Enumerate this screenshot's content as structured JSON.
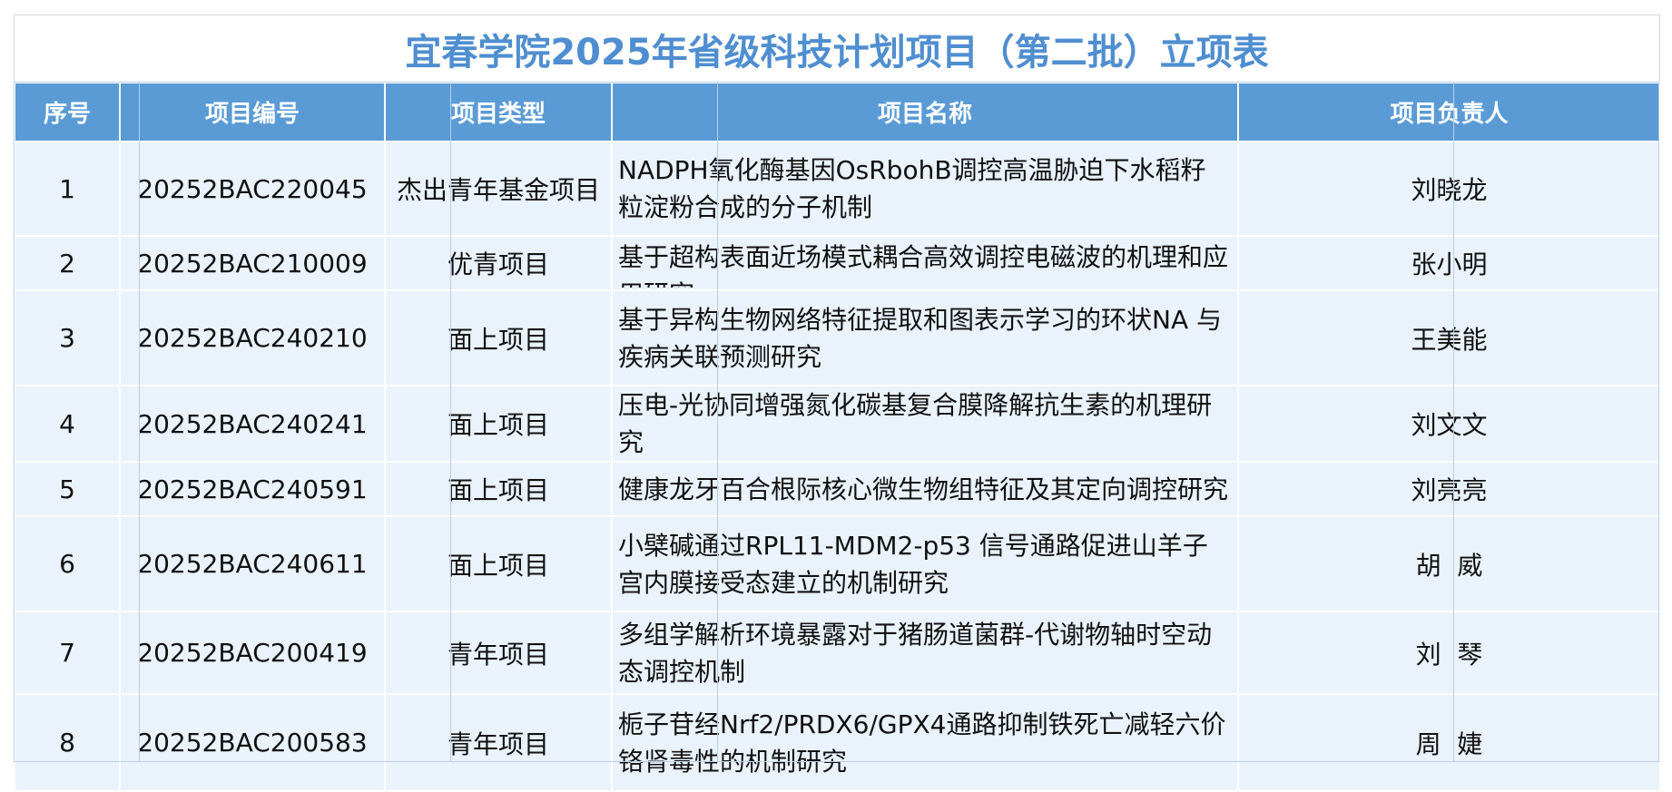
{
  "title": "宜春学院2025年省级科技计划项目（第二批）立项表",
  "columns": {
    "index": "序号",
    "code": "项目编号",
    "type": "项目类型",
    "name": "项目名称",
    "leader": "项目负责人"
  },
  "rows": [
    {
      "index": "1",
      "code": "20252BAC220045",
      "type": "杰出青年基金项目",
      "name": "NADPH氧化酶基因OsRbohB调控高温胁迫下水稻籽粒淀粉合成的分子机制",
      "leader": "刘晓龙"
    },
    {
      "index": "2",
      "code": "20252BAC210009",
      "type": "优青项目",
      "name": "基于超构表面近场模式耦合高效调控电磁波的机理和应用研究",
      "leader": "张小明"
    },
    {
      "index": "3",
      "code": "20252BAC240210",
      "type": "面上项目",
      "name": "基于异构生物网络特征提取和图表示学习的环状NA 与疾病关联预测研究",
      "leader": "王美能"
    },
    {
      "index": "4",
      "code": "20252BAC240241",
      "type": "面上项目",
      "name": "压电-光协同增强氮化碳基复合膜降解抗生素的机理研究",
      "leader": "刘文文"
    },
    {
      "index": "5",
      "code": "20252BAC240591",
      "type": "面上项目",
      "name": "健康龙牙百合根际核心微生物组特征及其定向调控研究",
      "leader": "刘亮亮"
    },
    {
      "index": "6",
      "code": "20252BAC240611",
      "type": "面上项目",
      "name": "小檗碱通过RPL11-MDM2-p53 信号通路促进山羊子宫内膜接受态建立的机制研究",
      "leader": "胡  威"
    },
    {
      "index": "7",
      "code": "20252BAC200419",
      "type": "青年项目",
      "name": "多组学解析环境暴露对于猪肠道菌群-代谢物轴时空动态调控机制",
      "leader": "刘  琴"
    },
    {
      "index": "8",
      "code": "20252BAC200583",
      "type": "青年项目",
      "name": "栀子苷经Nrf2/PRDX6/GPX4通路抑制铁死亡减轻六价铬肾毒性的机制研究",
      "leader": "周  婕"
    }
  ]
}
